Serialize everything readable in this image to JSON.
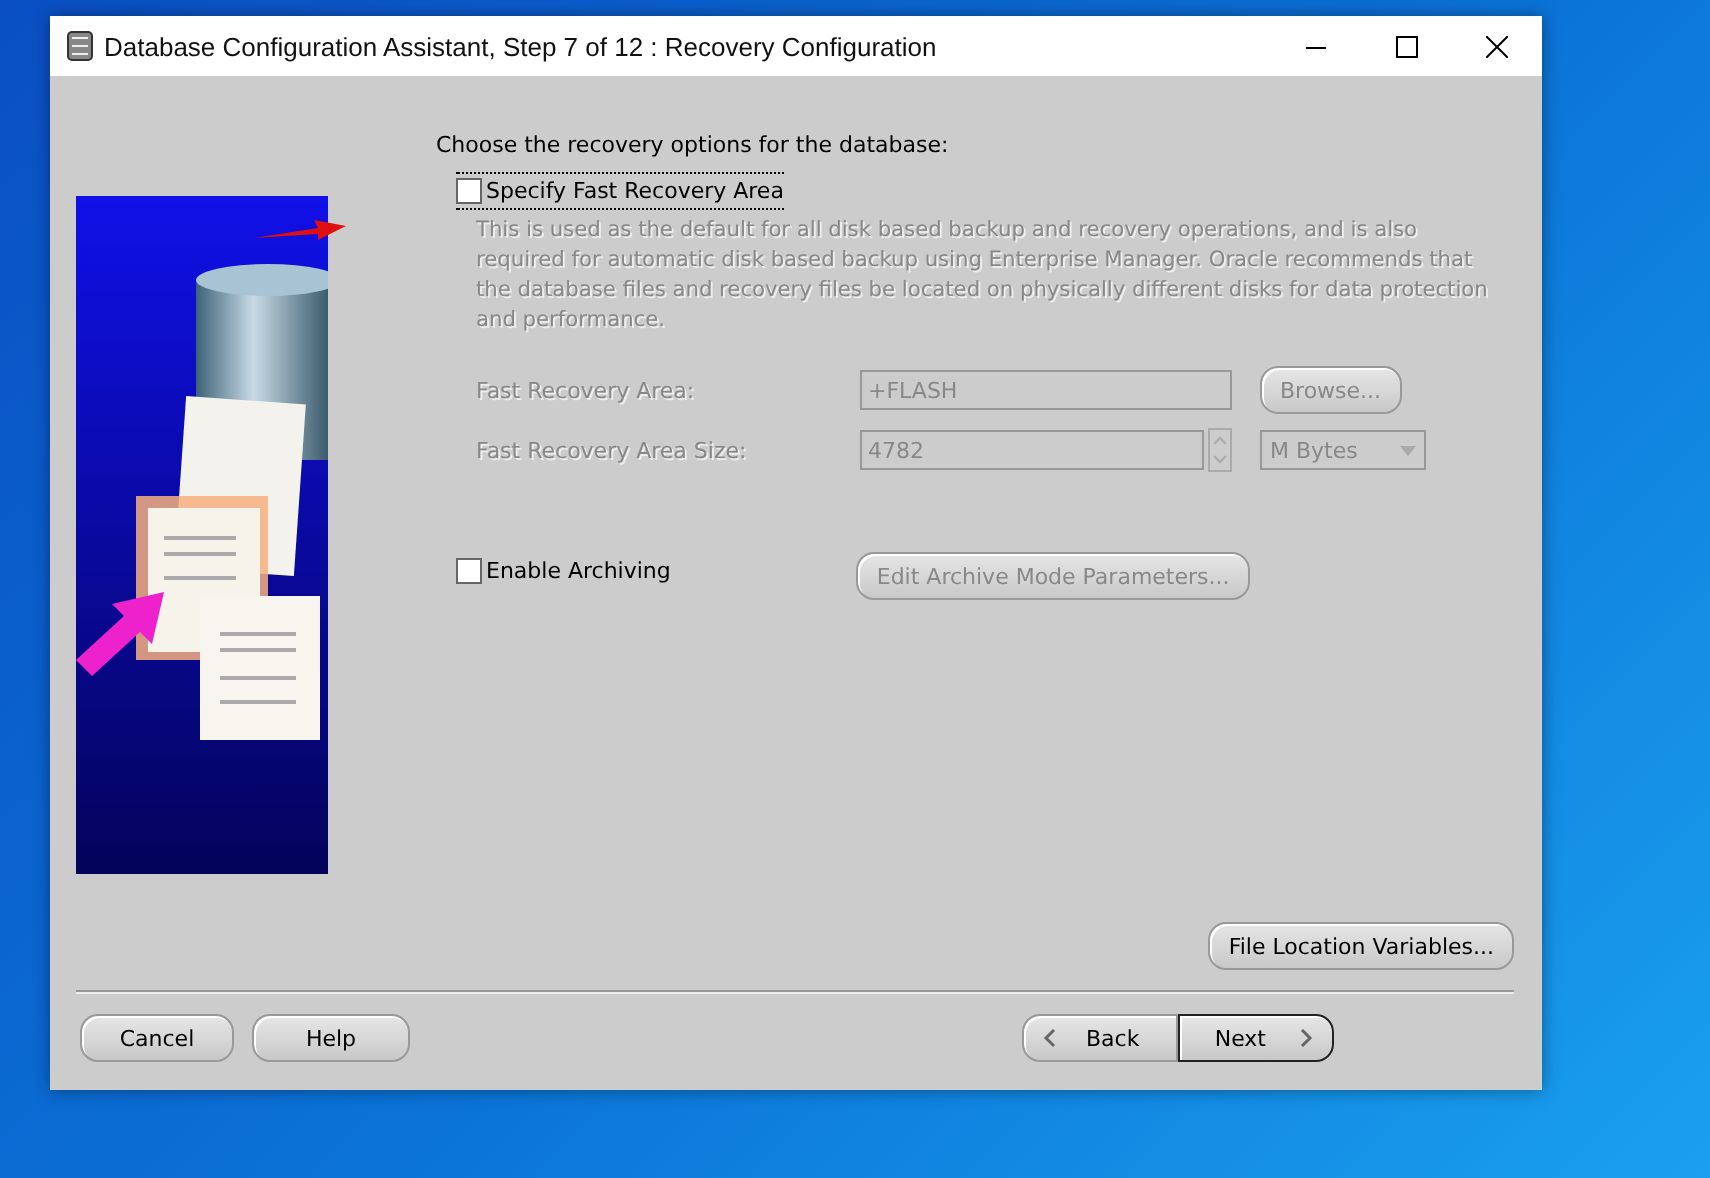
{
  "window": {
    "title": "Database Configuration Assistant, Step 7 of 12 : Recovery Configuration"
  },
  "heading": "Choose the recovery options for the database:",
  "recovery_area": {
    "checkbox": {
      "label": "Specify Fast Recovery Area",
      "checked": false,
      "focused": true
    },
    "description": "This is used as the default for all disk based backup and recovery operations, and is also required for automatic disk based backup using Enterprise Manager. Oracle recommends that the database files and recovery files be located on physically different disks for data protection and performance.",
    "fields": [
      {
        "kind": "browse",
        "label": "Fast Recovery Area:",
        "value": "+FLASH",
        "button": "Browse...",
        "disabled": true
      },
      {
        "kind": "size",
        "label": "Fast Recovery Area Size:",
        "value": "4782",
        "unit": "M Bytes",
        "disabled": true
      }
    ]
  },
  "archiving": {
    "checkbox": {
      "label": "Enable Archiving",
      "checked": false,
      "focused": false
    },
    "button": {
      "label": "Edit Archive Mode Parameters...",
      "disabled": true
    }
  },
  "file_location_button": "File Location Variables...",
  "footer": {
    "left_buttons": [
      "Cancel",
      "Help"
    ],
    "back": "Back",
    "next": {
      "label": "Next",
      "default": true
    }
  }
}
